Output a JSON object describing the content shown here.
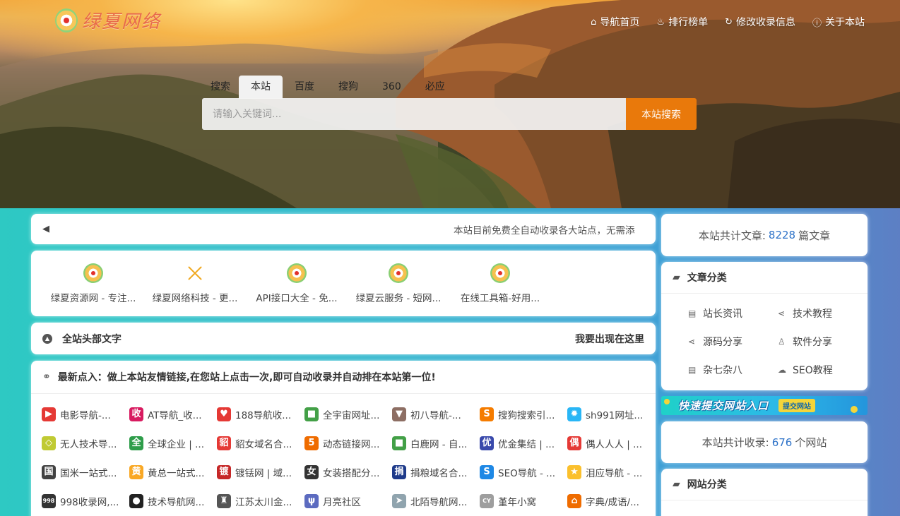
{
  "header": {
    "logo_text": "绿夏网络",
    "nav": [
      {
        "icon": "home-icon",
        "glyph": "⌂",
        "label": "导航首页"
      },
      {
        "icon": "fire-icon",
        "glyph": "♨",
        "label": "排行榜单"
      },
      {
        "icon": "refresh-icon",
        "glyph": "↻",
        "label": "修改收录信息"
      },
      {
        "icon": "info-icon",
        "glyph": "ⓘ",
        "label": "关于本站"
      }
    ]
  },
  "search": {
    "label": "搜索",
    "tabs": [
      "本站",
      "百度",
      "搜狗",
      "360",
      "必应"
    ],
    "active_tab": "本站",
    "placeholder": "请输入关键词...",
    "button": "本站搜索"
  },
  "notice": {
    "text": "本站目前免费全自动收录各大站点，无需添"
  },
  "featured": [
    {
      "icon": "lvxia-logo-icon",
      "label": "绿夏资源网 - 专注..."
    },
    {
      "icon": "cross-icon",
      "label": "绿夏网络科技 - 更..."
    },
    {
      "icon": "lvxia-logo-icon",
      "label": "API接口大全 - 免..."
    },
    {
      "icon": "lvxia-logo-icon",
      "label": "绿夏云服务 - 短网..."
    },
    {
      "icon": "lvxia-logo-icon",
      "label": "在线工具箱-好用..."
    }
  ],
  "headline": {
    "title": "全站头部文字",
    "action": "我要出现在这里"
  },
  "links": {
    "title": "最新点入：做上本站友情链接,在您站上点击一次,即可自动收录并自动排在本站第一位!",
    "items": [
      {
        "glyph": "▶",
        "color": "#e53935",
        "label": "电影导航-..."
      },
      {
        "glyph": "收",
        "color": "#d81b60",
        "label": "AT导航_收..."
      },
      {
        "glyph": "♥",
        "color": "#e53935",
        "label": "188导航收..."
      },
      {
        "glyph": "■",
        "color": "#43a047",
        "label": "全宇宙网址..."
      },
      {
        "glyph": "▼",
        "color": "#8d6e63",
        "label": "初八导航-..."
      },
      {
        "glyph": "S",
        "color": "#f57c00",
        "label": "搜狗搜索引..."
      },
      {
        "glyph": "✹",
        "color": "#29b6f6",
        "label": "sh991网址..."
      },
      {
        "glyph": "◇",
        "color": "#c0ca33",
        "label": "无人技术导..."
      },
      {
        "glyph": "全",
        "color": "#2e9d4a",
        "label": "全球企业 | ..."
      },
      {
        "glyph": "貂",
        "color": "#e53935",
        "label": "貂女域名合..."
      },
      {
        "glyph": "5",
        "color": "#ef6c00",
        "label": "动态链接网..."
      },
      {
        "glyph": "■",
        "color": "#43a047",
        "label": "白鹿网 - 自..."
      },
      {
        "glyph": "优",
        "color": "#3949ab",
        "label": "优金集结 | ..."
      },
      {
        "glyph": "偶",
        "color": "#e53935",
        "label": "偶人人人 | ..."
      },
      {
        "glyph": "国",
        "color": "#424242",
        "label": "国米一站式..."
      },
      {
        "glyph": "黄",
        "color": "#f9a825",
        "label": "黄总一站式..."
      },
      {
        "glyph": "镀",
        "color": "#c62828",
        "label": "镀铥网 | 域..."
      },
      {
        "glyph": "女",
        "color": "#333333",
        "label": "女装搭配分..."
      },
      {
        "glyph": "捐",
        "color": "#1e3a8a",
        "label": "捐粮域名合..."
      },
      {
        "glyph": "S",
        "color": "#1e88e5",
        "label": "SEO导航 - ..."
      },
      {
        "glyph": "★",
        "color": "#fbc02d",
        "label": "泪应导航 - ..."
      },
      {
        "glyph": "998",
        "color": "#333333",
        "label": "998收录网,..."
      },
      {
        "glyph": "●",
        "color": "#222222",
        "label": "技术导航网..."
      },
      {
        "glyph": "♜",
        "color": "#555555",
        "label": "江苏太川金..."
      },
      {
        "glyph": "ψ",
        "color": "#5c6bc0",
        "label": "月亮社区"
      },
      {
        "glyph": "➤",
        "color": "#90a4ae",
        "label": "北陌导航网..."
      },
      {
        "glyph": "CY",
        "color": "#9e9e9e",
        "label": "堇年小窝"
      },
      {
        "glyph": "⌂",
        "color": "#ef6c00",
        "label": "字典/成语/..."
      }
    ]
  },
  "sidebar": {
    "articles": {
      "prefix": "本站共计文章:",
      "count": "8228",
      "suffix": "篇文章"
    },
    "article_categories": {
      "title": "文章分类",
      "items": [
        {
          "icon": "newspaper-icon",
          "glyph": "▤",
          "label": "站长资讯"
        },
        {
          "icon": "share-icon",
          "glyph": "⋖",
          "label": "技术教程"
        },
        {
          "icon": "share-icon",
          "glyph": "⋖",
          "label": "源码分享"
        },
        {
          "icon": "thumbs-up-icon",
          "glyph": "♙",
          "label": "软件分享"
        },
        {
          "icon": "newspaper-icon",
          "glyph": "▤",
          "label": "杂七杂八"
        },
        {
          "icon": "cloud-icon",
          "glyph": "☁",
          "label": "SEO教程"
        }
      ]
    },
    "banner": {
      "text": "快速提交网站入口",
      "badge": "提交网站"
    },
    "sites": {
      "prefix": "本站共计收录:",
      "count": "676",
      "suffix": "个网站"
    },
    "site_categories": {
      "title": "网站分类"
    }
  }
}
